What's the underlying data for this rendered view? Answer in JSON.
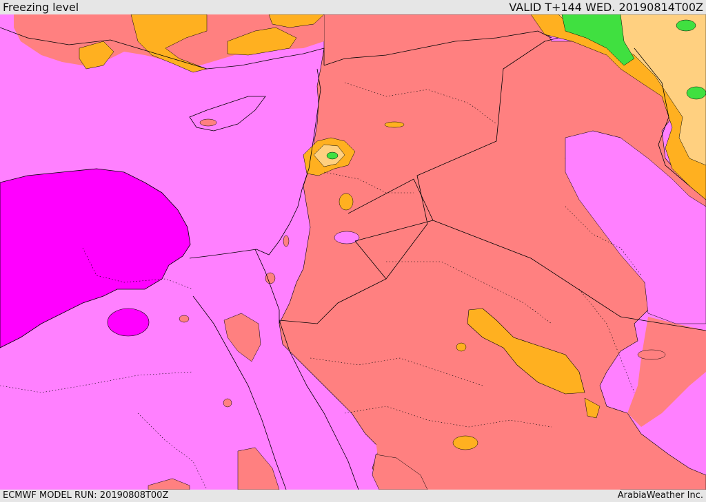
{
  "header": {
    "title": "Freezing level",
    "valid": "VALID T+144 WED. 20190814T00Z"
  },
  "footer": {
    "model_run": "ECMWF MODEL RUN: 20190808T00Z",
    "brand": "ArabiaWeather Inc."
  },
  "map": {
    "colors": {
      "background_low": "#ff80ff",
      "lowest": "#ff00ff",
      "mid": "#ff8080",
      "warm": "#ffb020",
      "warmer": "#ffd080",
      "pale": "#f0ff80",
      "high": "#40e040",
      "boundary": "#000000"
    }
  }
}
